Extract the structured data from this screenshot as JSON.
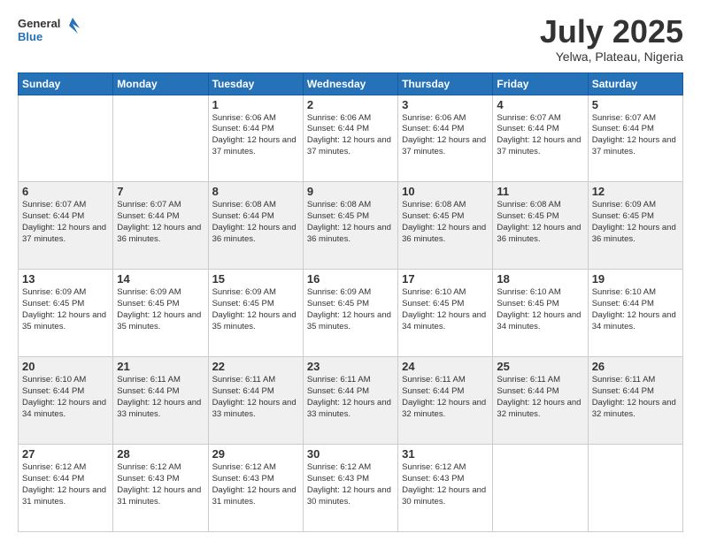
{
  "logo": {
    "line1": "General",
    "line2": "Blue"
  },
  "header": {
    "month": "July 2025",
    "location": "Yelwa, Plateau, Nigeria"
  },
  "weekdays": [
    "Sunday",
    "Monday",
    "Tuesday",
    "Wednesday",
    "Thursday",
    "Friday",
    "Saturday"
  ],
  "weeks": [
    [
      {
        "day": "",
        "info": ""
      },
      {
        "day": "",
        "info": ""
      },
      {
        "day": "1",
        "info": "Sunrise: 6:06 AM\nSunset: 6:44 PM\nDaylight: 12 hours and 37 minutes."
      },
      {
        "day": "2",
        "info": "Sunrise: 6:06 AM\nSunset: 6:44 PM\nDaylight: 12 hours and 37 minutes."
      },
      {
        "day": "3",
        "info": "Sunrise: 6:06 AM\nSunset: 6:44 PM\nDaylight: 12 hours and 37 minutes."
      },
      {
        "day": "4",
        "info": "Sunrise: 6:07 AM\nSunset: 6:44 PM\nDaylight: 12 hours and 37 minutes."
      },
      {
        "day": "5",
        "info": "Sunrise: 6:07 AM\nSunset: 6:44 PM\nDaylight: 12 hours and 37 minutes."
      }
    ],
    [
      {
        "day": "6",
        "info": "Sunrise: 6:07 AM\nSunset: 6:44 PM\nDaylight: 12 hours and 37 minutes."
      },
      {
        "day": "7",
        "info": "Sunrise: 6:07 AM\nSunset: 6:44 PM\nDaylight: 12 hours and 36 minutes."
      },
      {
        "day": "8",
        "info": "Sunrise: 6:08 AM\nSunset: 6:44 PM\nDaylight: 12 hours and 36 minutes."
      },
      {
        "day": "9",
        "info": "Sunrise: 6:08 AM\nSunset: 6:45 PM\nDaylight: 12 hours and 36 minutes."
      },
      {
        "day": "10",
        "info": "Sunrise: 6:08 AM\nSunset: 6:45 PM\nDaylight: 12 hours and 36 minutes."
      },
      {
        "day": "11",
        "info": "Sunrise: 6:08 AM\nSunset: 6:45 PM\nDaylight: 12 hours and 36 minutes."
      },
      {
        "day": "12",
        "info": "Sunrise: 6:09 AM\nSunset: 6:45 PM\nDaylight: 12 hours and 36 minutes."
      }
    ],
    [
      {
        "day": "13",
        "info": "Sunrise: 6:09 AM\nSunset: 6:45 PM\nDaylight: 12 hours and 35 minutes."
      },
      {
        "day": "14",
        "info": "Sunrise: 6:09 AM\nSunset: 6:45 PM\nDaylight: 12 hours and 35 minutes."
      },
      {
        "day": "15",
        "info": "Sunrise: 6:09 AM\nSunset: 6:45 PM\nDaylight: 12 hours and 35 minutes."
      },
      {
        "day": "16",
        "info": "Sunrise: 6:09 AM\nSunset: 6:45 PM\nDaylight: 12 hours and 35 minutes."
      },
      {
        "day": "17",
        "info": "Sunrise: 6:10 AM\nSunset: 6:45 PM\nDaylight: 12 hours and 34 minutes."
      },
      {
        "day": "18",
        "info": "Sunrise: 6:10 AM\nSunset: 6:45 PM\nDaylight: 12 hours and 34 minutes."
      },
      {
        "day": "19",
        "info": "Sunrise: 6:10 AM\nSunset: 6:44 PM\nDaylight: 12 hours and 34 minutes."
      }
    ],
    [
      {
        "day": "20",
        "info": "Sunrise: 6:10 AM\nSunset: 6:44 PM\nDaylight: 12 hours and 34 minutes."
      },
      {
        "day": "21",
        "info": "Sunrise: 6:11 AM\nSunset: 6:44 PM\nDaylight: 12 hours and 33 minutes."
      },
      {
        "day": "22",
        "info": "Sunrise: 6:11 AM\nSunset: 6:44 PM\nDaylight: 12 hours and 33 minutes."
      },
      {
        "day": "23",
        "info": "Sunrise: 6:11 AM\nSunset: 6:44 PM\nDaylight: 12 hours and 33 minutes."
      },
      {
        "day": "24",
        "info": "Sunrise: 6:11 AM\nSunset: 6:44 PM\nDaylight: 12 hours and 32 minutes."
      },
      {
        "day": "25",
        "info": "Sunrise: 6:11 AM\nSunset: 6:44 PM\nDaylight: 12 hours and 32 minutes."
      },
      {
        "day": "26",
        "info": "Sunrise: 6:11 AM\nSunset: 6:44 PM\nDaylight: 12 hours and 32 minutes."
      }
    ],
    [
      {
        "day": "27",
        "info": "Sunrise: 6:12 AM\nSunset: 6:44 PM\nDaylight: 12 hours and 31 minutes."
      },
      {
        "day": "28",
        "info": "Sunrise: 6:12 AM\nSunset: 6:43 PM\nDaylight: 12 hours and 31 minutes."
      },
      {
        "day": "29",
        "info": "Sunrise: 6:12 AM\nSunset: 6:43 PM\nDaylight: 12 hours and 31 minutes."
      },
      {
        "day": "30",
        "info": "Sunrise: 6:12 AM\nSunset: 6:43 PM\nDaylight: 12 hours and 30 minutes."
      },
      {
        "day": "31",
        "info": "Sunrise: 6:12 AM\nSunset: 6:43 PM\nDaylight: 12 hours and 30 minutes."
      },
      {
        "day": "",
        "info": ""
      },
      {
        "day": "",
        "info": ""
      }
    ]
  ]
}
